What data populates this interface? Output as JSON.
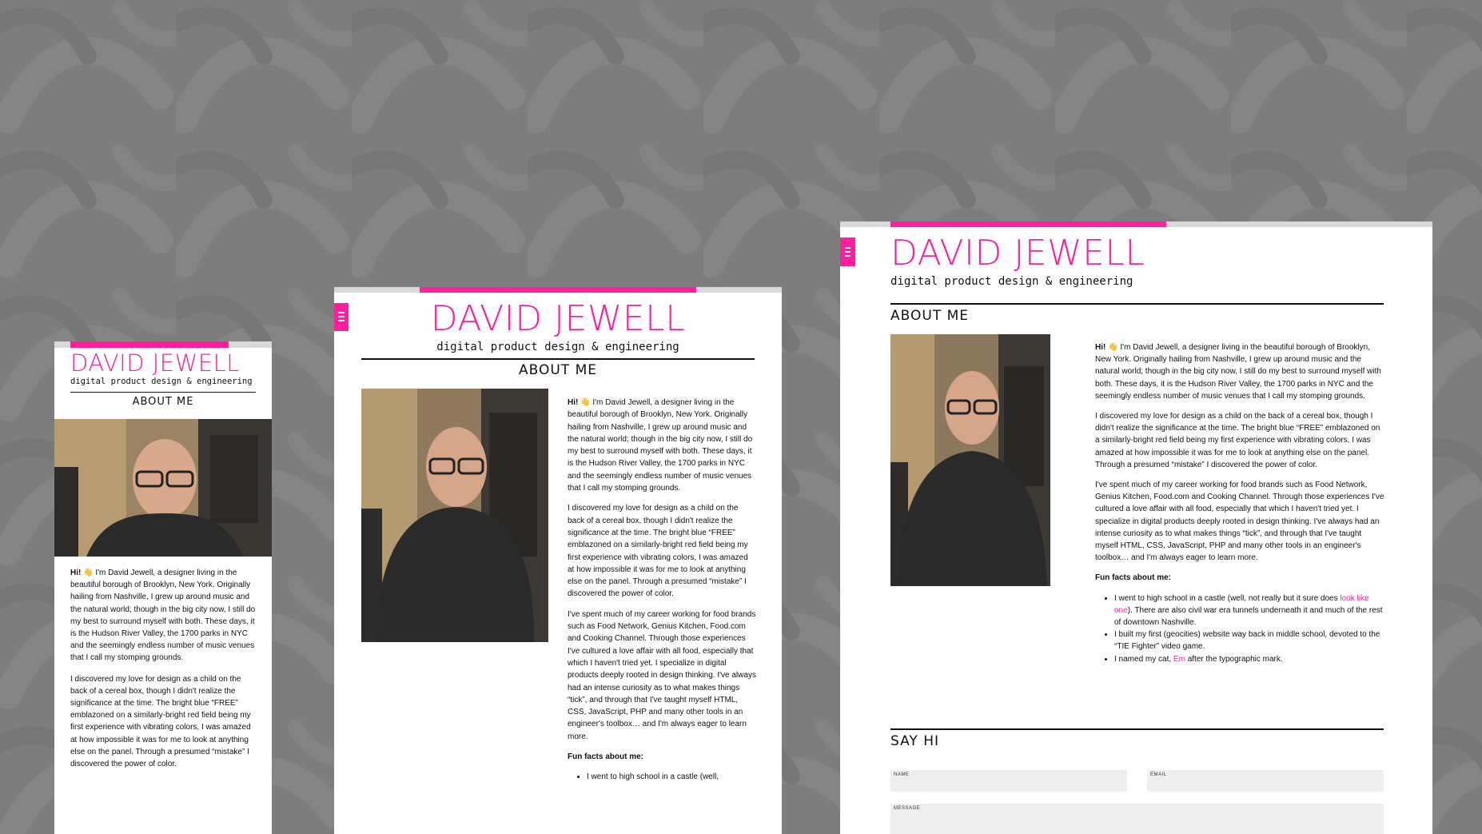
{
  "site": {
    "name": "DAVID JEWELL",
    "tagline": "digital product design & engineering"
  },
  "colors": {
    "accent": "#ff1f9e",
    "background": "#7d7d7d",
    "page": "#ffffff"
  },
  "about": {
    "heading": "ABOUT ME",
    "hi": "Hi!",
    "wave_icon": "👋",
    "p1": "I'm David Jewell, a designer living in the beautiful borough of Brooklyn, New York. Originally hailing from Nashville, I grew up around music and the natural world; though in the big city now, I still do my best to surround myself with both. These days, it is the Hudson River Valley, the 1700 parks in NYC and the seemingly endless number of music venues that I call my stomping grounds.",
    "p2": "I discovered my love for design as a child on the back of a cereal box, though I didn't realize the significance at the time. The bright blue “FREE” emblazoned on a similarly-bright red field being my first experience with vibrating colors, I was amazed at how impossible it was for me to look at anything else on the panel. Through a presumed “mistake” I discovered the power of color.",
    "p3": "I've spent much of my career working for food brands such as Food Network, Genius Kitchen, Food.com and Cooking Channel. Through those experiences I've cultured a love affair with all food, especially that which I haven't tried yet. I specialize in digital products deeply rooted in design thinking. I've always had an intense curiosity as to what makes things “tick”, and through that I've taught myself HTML, CSS, JavaScript, PHP and many other tools in an engineer's toolbox… and I'm always eager to learn more.",
    "fun_facts_heading": "Fun facts about me:",
    "facts": [
      {
        "before": "I went to high school in a castle (well, not really but it sure does ",
        "link": "look like one",
        "after": "). There are also civil war era tunnels underneath it and much of the rest of downtown Nashville."
      },
      {
        "before": "I built my first (geocities) website way back in middle school, devoted to the “TIE Fighter” video game.",
        "link": "",
        "after": ""
      },
      {
        "before": "I named my cat, ",
        "link": "Em",
        "after": " after the typographic mark."
      }
    ],
    "fact1_partial": "I went to high school in a castle (well,"
  },
  "say_hi": {
    "heading": "SAY HI",
    "name_label": "NAME",
    "email_label": "EMAIL",
    "message_label": "MESSAGE"
  },
  "icons": {
    "menu": "hamburger-menu-icon",
    "wave": "waving-hand-icon"
  }
}
